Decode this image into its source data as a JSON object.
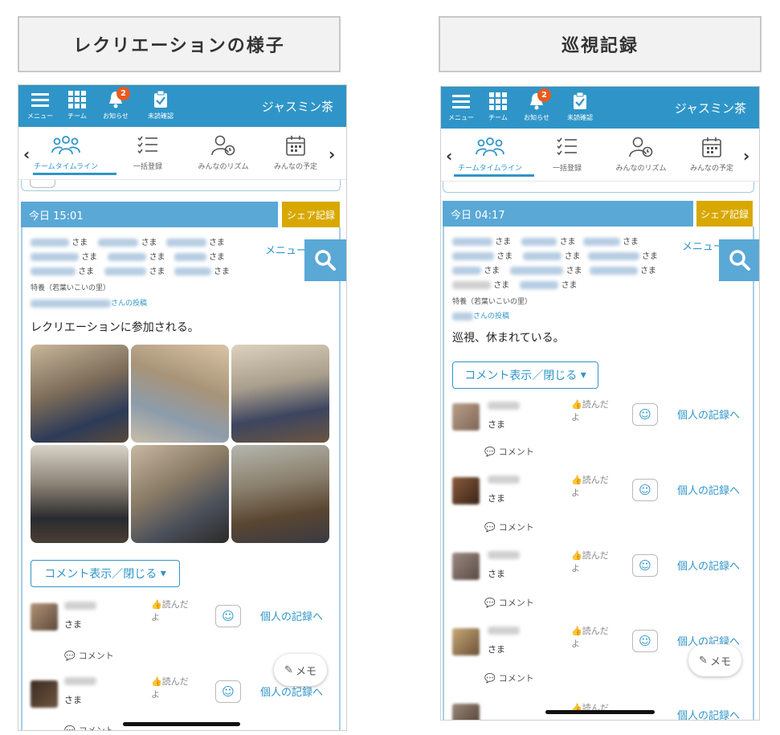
{
  "left": {
    "heading": "レクリエーションの様子",
    "app_title": "ジャスミン茶",
    "topbar": {
      "menu": "メニュー",
      "team": "チーム",
      "notice": "お知らせ",
      "notice_badge": "2",
      "unread": "未読確認"
    },
    "subnav": {
      "timeline": "チームタイムライン",
      "bulk": "一括登録",
      "rhythm": "みんなのリズム",
      "schedule": "みんなの予定"
    },
    "post": {
      "date": "今日 15:01",
      "share_label": "シェア記録",
      "sama": "さま",
      "menu_label": "メニュー",
      "facility": "特養（若葉いこいの里）",
      "poster_suffix": "さんの投稿",
      "body": "レクリエーションに参加される。",
      "photo_count": 6
    },
    "comment_toggle": "コメント表示／閉じる",
    "residents": [
      {
        "sama": "さま",
        "read": "読んだ",
        "read2": "よ",
        "link": "個人の記録へ",
        "comment": "コメント"
      },
      {
        "sama": "さま",
        "read": "読んだ",
        "read2": "よ",
        "link": "個人の記録へ",
        "comment": "コメント"
      }
    ],
    "memo_label": "メモ"
  },
  "right": {
    "heading": "巡視記録",
    "app_title": "ジャスミン茶",
    "topbar": {
      "menu": "メニュー",
      "team": "チーム",
      "notice": "お知らせ",
      "notice_badge": "2",
      "unread": "未読確認"
    },
    "subnav": {
      "timeline": "チームタイムライン",
      "bulk": "一括登録",
      "rhythm": "みんなのリズム",
      "schedule": "みんなの予定"
    },
    "post": {
      "date": "今日 04:17",
      "share_label": "シェア記録",
      "sama": "さま",
      "menu_label": "メニュー",
      "facility": "特養（若葉いこいの里）",
      "poster_suffix": "さんの投稿",
      "body": "巡視、休まれている。"
    },
    "comment_toggle": "コメント表示／閉じる",
    "residents": [
      {
        "sama": "さま",
        "read": "読んだ",
        "read2": "よ",
        "link": "個人の記録へ",
        "comment": "コメント"
      },
      {
        "sama": "さま",
        "read": "読んだ",
        "read2": "よ",
        "link": "個人の記録へ",
        "comment": "コメント"
      },
      {
        "sama": "さま",
        "read": "読んだ",
        "read2": "よ",
        "link": "個人の記録へ",
        "comment": "コメント"
      },
      {
        "sama": "さま",
        "read": "読んだ",
        "read2": "よ",
        "link": "個人の記録へ",
        "comment": "コメント"
      },
      {
        "sama": "さま",
        "read": "読んだ",
        "read2": "",
        "link": "個人の記録へ",
        "comment": ""
      }
    ],
    "memo_label": "メモ"
  },
  "colors": {
    "primary": "#2f95c8",
    "date_bar": "#5aa8d6",
    "share": "#d8a800",
    "badge": "#ea5a1e"
  }
}
